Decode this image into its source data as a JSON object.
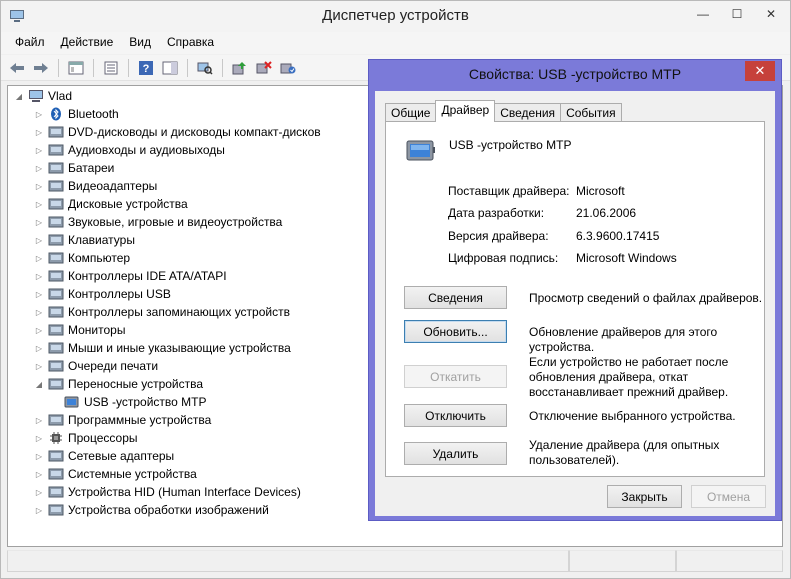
{
  "window": {
    "title": "Диспетчер устройств",
    "controls": [
      "—",
      "☐",
      "✕"
    ]
  },
  "menu": [
    "Файл",
    "Действие",
    "Вид",
    "Справка"
  ],
  "tree": {
    "root": "Vlad",
    "items": [
      {
        "label": "Bluetooth",
        "icon": "bluetooth-icon"
      },
      {
        "label": "DVD-дисководы и дисководы компакт-дисков",
        "icon": "dvd-drive-icon"
      },
      {
        "label": "Аудиовходы и аудиовыходы",
        "icon": "speaker-icon"
      },
      {
        "label": "Батареи",
        "icon": "battery-icon"
      },
      {
        "label": "Видеоадаптеры",
        "icon": "display-adapter-icon"
      },
      {
        "label": "Дисковые устройства",
        "icon": "disk-drive-icon"
      },
      {
        "label": "Звуковые, игровые и видеоустройства",
        "icon": "sound-icon"
      },
      {
        "label": "Клавиатуры",
        "icon": "keyboard-icon"
      },
      {
        "label": "Компьютер",
        "icon": "computer-icon"
      },
      {
        "label": "Контроллеры IDE ATA/ATAPI",
        "icon": "ide-controller-icon"
      },
      {
        "label": "Контроллеры USB",
        "icon": "usb-icon"
      },
      {
        "label": "Контроллеры запоминающих устройств",
        "icon": "storage-controller-icon"
      },
      {
        "label": "Мониторы",
        "icon": "monitor-icon"
      },
      {
        "label": "Мыши и иные указывающие устройства",
        "icon": "mouse-icon"
      },
      {
        "label": "Очереди печати",
        "icon": "printer-icon"
      },
      {
        "label": "Переносные устройства",
        "icon": "portable-device-icon"
      },
      {
        "label": "USB -устройство MTP",
        "icon": "mtp-device-icon"
      },
      {
        "label": "Программные устройства",
        "icon": "software-device-icon"
      },
      {
        "label": "Процессоры",
        "icon": "processor-icon"
      },
      {
        "label": "Сетевые адаптеры",
        "icon": "network-adapter-icon"
      },
      {
        "label": "Системные устройства",
        "icon": "system-device-icon"
      },
      {
        "label": "Устройства HID (Human Interface Devices)",
        "icon": "hid-icon"
      },
      {
        "label": "Устройства обработки изображений",
        "icon": "imaging-device-icon"
      }
    ]
  },
  "dialog": {
    "title": "Свойства: USB -устройство MTP",
    "close": "✕",
    "tabs": [
      "Общие",
      "Драйвер",
      "Сведения",
      "События"
    ],
    "device_name": "USB -устройство MTP",
    "props": [
      {
        "label": "Поставщик драйвера:",
        "value": "Microsoft"
      },
      {
        "label": "Дата разработки:",
        "value": "21.06.2006"
      },
      {
        "label": "Версия драйвера:",
        "value": "6.3.9600.17415"
      },
      {
        "label": "Цифровая подпись:",
        "value": "Microsoft Windows"
      }
    ],
    "actions": [
      {
        "button": "Сведения",
        "desc": "Просмотр сведений о файлах драйверов."
      },
      {
        "button": "Обновить...",
        "desc": "Обновление драйверов для этого устройства."
      },
      {
        "button": "Откатить",
        "desc": "Если устройство не работает после обновления драйвера, откат восстанавливает прежний драйвер."
      },
      {
        "button": "Отключить",
        "desc": "Отключение выбранного устройства."
      },
      {
        "button": "Удалить",
        "desc": "Удаление драйвера (для опытных пользователей)."
      }
    ],
    "ok": "Закрыть",
    "cancel": "Отмена"
  }
}
